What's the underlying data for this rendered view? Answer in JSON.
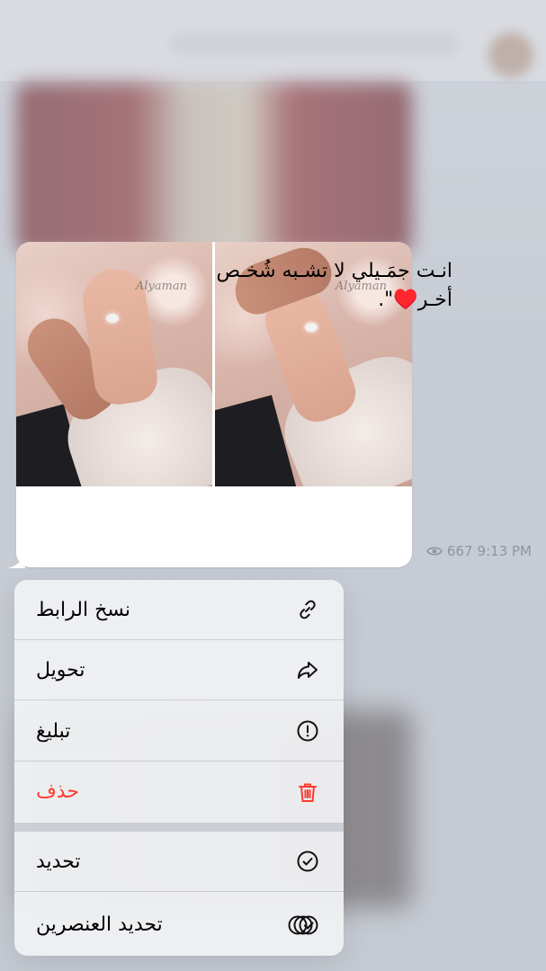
{
  "message": {
    "text": "انـت جمَـيلي لا تشـبه شُخـص أخـر♥️\".",
    "views": "667",
    "time": "9:13 PM",
    "watermark": "Alyaman"
  },
  "menu": {
    "items": [
      {
        "label": "نسخ الرابط",
        "icon": "link-icon"
      },
      {
        "label": "تحويل",
        "icon": "forward-icon"
      },
      {
        "label": "تبليغ",
        "icon": "report-icon"
      },
      {
        "label": "حذف",
        "icon": "trash-icon"
      },
      {
        "label": "تحديد",
        "icon": "checkmark-circle-icon"
      },
      {
        "label": "تحديد العنصرين",
        "icon": "select-all-icon"
      }
    ]
  },
  "colors": {
    "danger": "#ff3b30",
    "meta": "#8e959c"
  }
}
